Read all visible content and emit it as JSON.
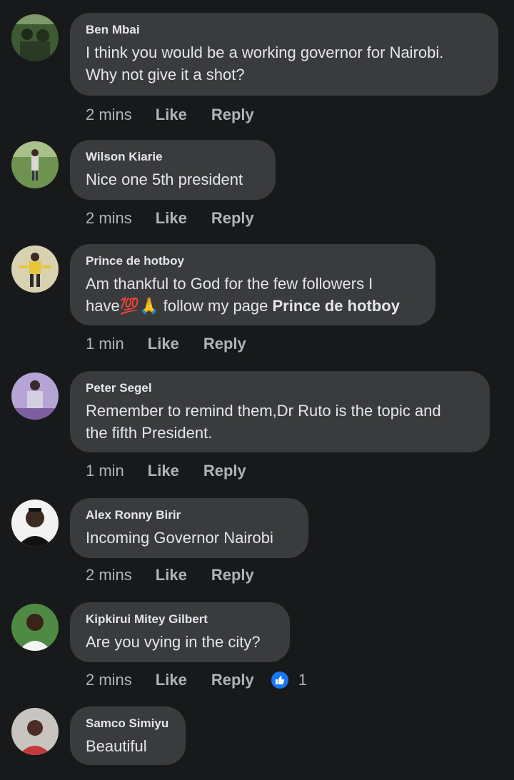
{
  "comments": [
    {
      "author": "Ben Mbai",
      "lines": [
        "I think you would be a working governor for Nairobi.",
        "Why not give it a shot?"
      ],
      "time": "2 mins",
      "like": "Like",
      "reply": "Reply",
      "avatar_color": "#4a6a3c"
    },
    {
      "author": "Wilson Kiarie",
      "lines": [
        "Nice one 5th president"
      ],
      "time": "2 mins",
      "like": "Like",
      "reply": "Reply",
      "avatar_color": "#6d8f4a"
    },
    {
      "author": "Prince de hotboy",
      "line1": "Am thankful to God for the few followers I",
      "line2_prefix": "have",
      "emoji_100": "💯",
      "emoji_pray": "🙏",
      "line2_mid": " follow my page ",
      "mention": "Prince de hotboy",
      "time": "1 min",
      "like": "Like",
      "reply": "Reply",
      "avatar_color": "#c9b46a"
    },
    {
      "author": "Peter Segel",
      "lines": [
        "Remember to remind them,Dr Ruto is the topic and",
        "the fifth President."
      ],
      "time": "1 min",
      "like": "Like",
      "reply": "Reply",
      "avatar_color": "#8c6bb0"
    },
    {
      "author": "Alex Ronny Birir",
      "lines": [
        "Incoming Governor Nairobi"
      ],
      "time": "2 mins",
      "like": "Like",
      "reply": "Reply",
      "avatar_color": "#2a2a2a"
    },
    {
      "author": "Kipkirui Mitey Gilbert",
      "lines": [
        "Are you vying in the city?"
      ],
      "time": "2 mins",
      "like": "Like",
      "reply": "Reply",
      "reaction_count": "1",
      "avatar_color": "#3f7a3a"
    },
    {
      "author": "Samco Simiyu",
      "lines": [
        "Beautiful"
      ],
      "avatar_color": "#b04040"
    }
  ],
  "colors": {
    "background": "#18191a",
    "bubble": "#3a3b3c",
    "text": "#e4e6eb",
    "meta": "#b0b3b8",
    "like_reaction": "#1877f2"
  }
}
